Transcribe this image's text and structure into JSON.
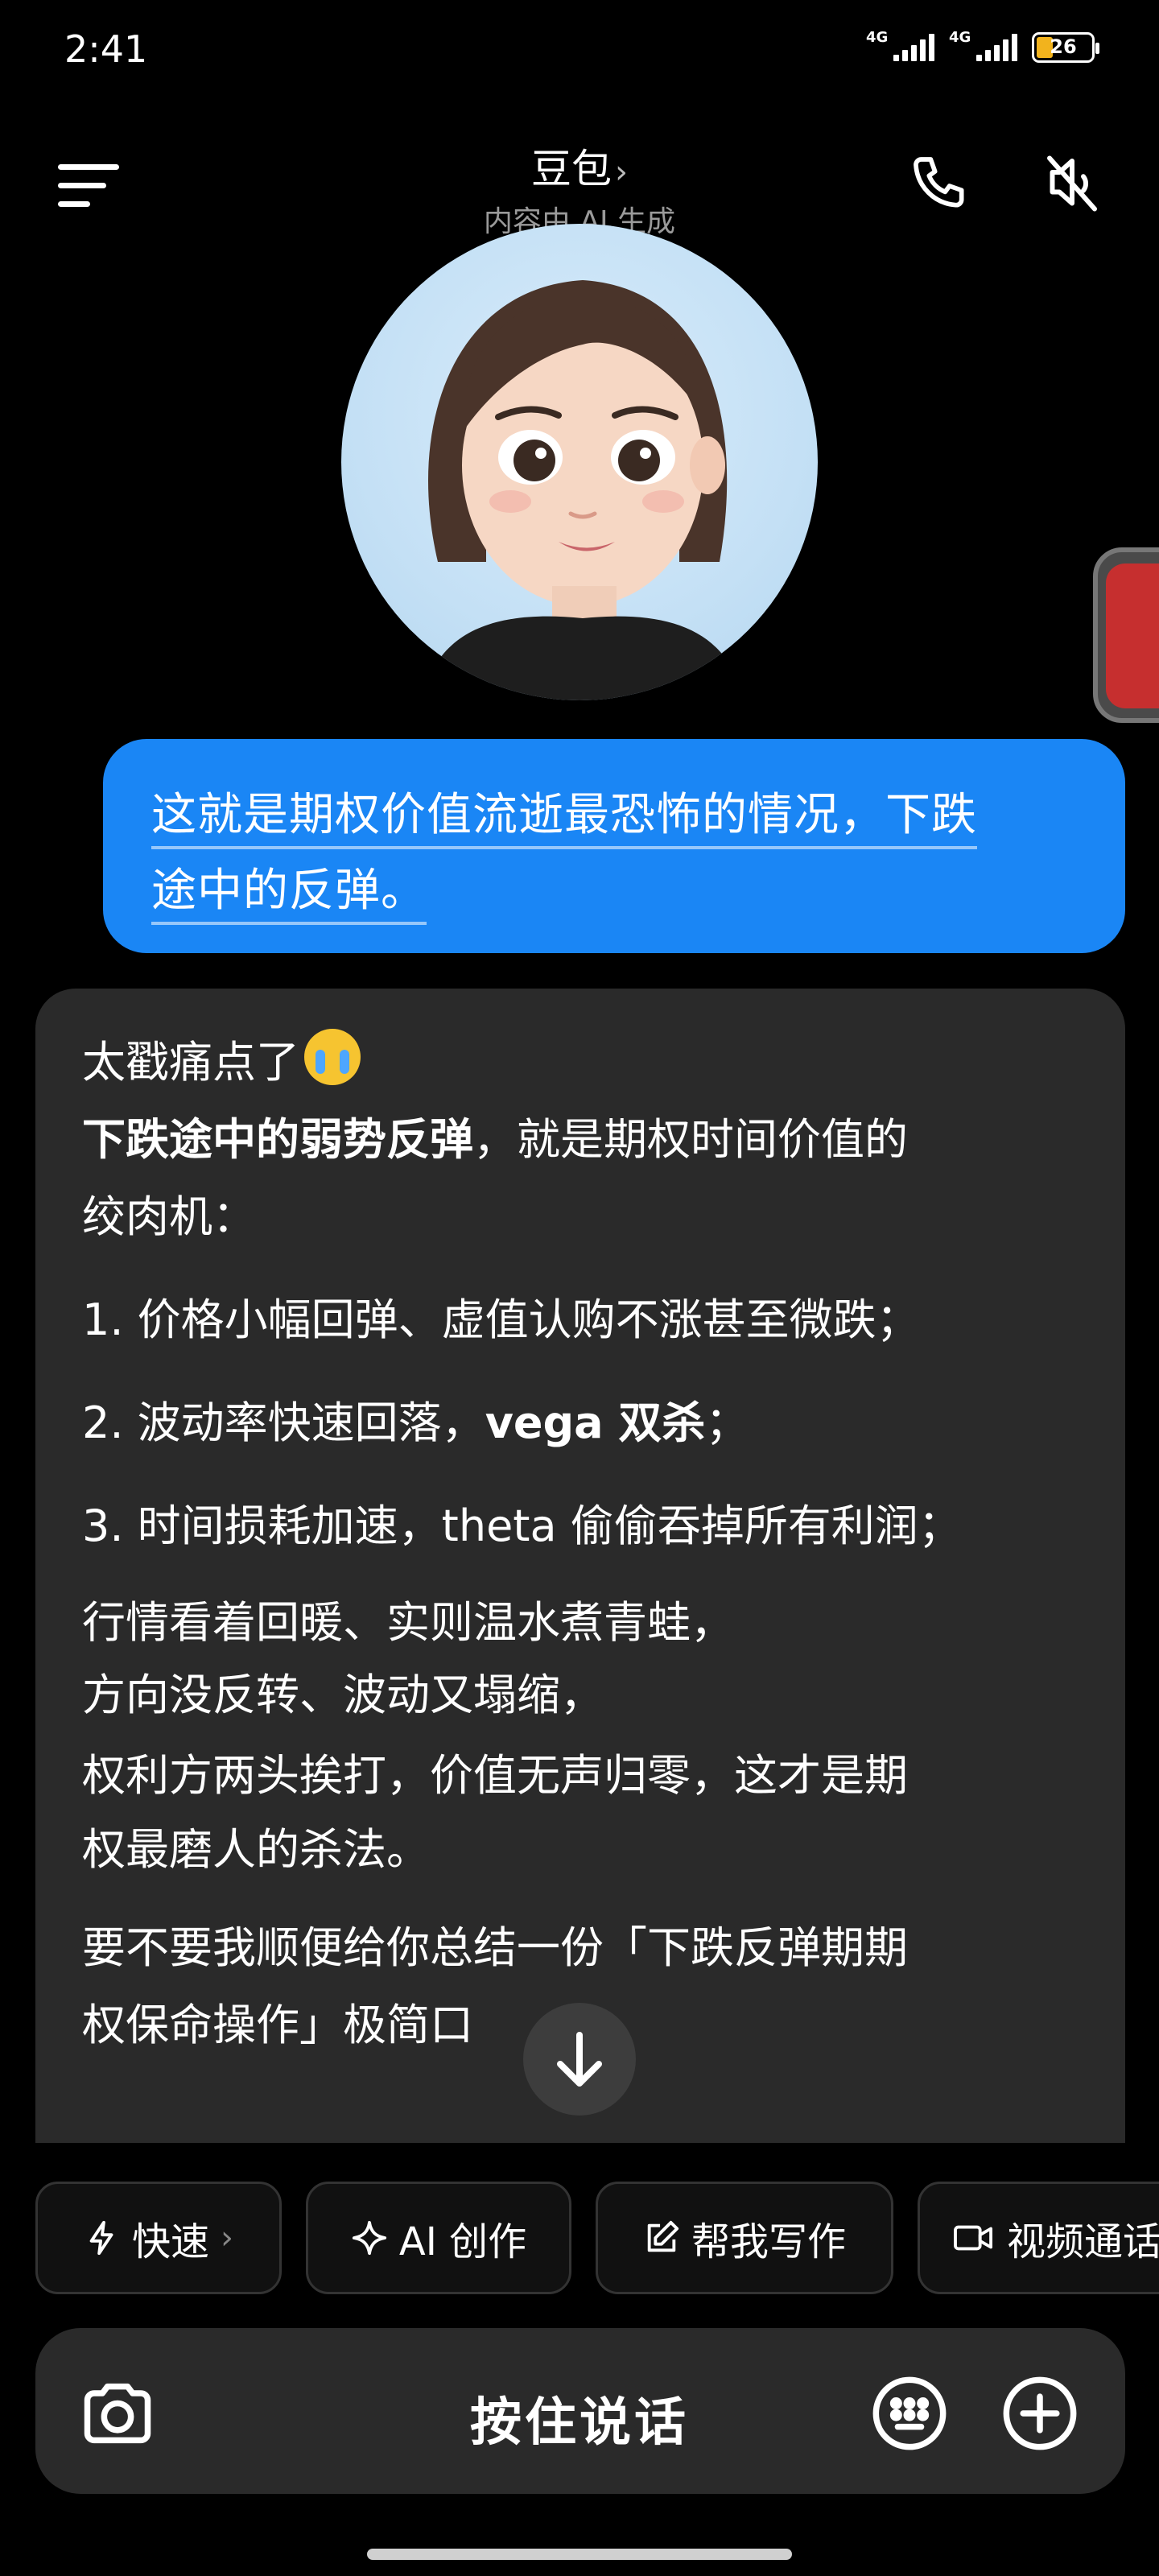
{
  "status_bar": {
    "time": "2:41",
    "network_1": "4G",
    "network_2": "4G",
    "battery": "26"
  },
  "header": {
    "title": "豆包",
    "title_chevron": "›",
    "subtitle": "内容由 AI 生成"
  },
  "user_message": {
    "line1": "这就是期权价值流逝最恐怖的情况，下跌",
    "line2": "途中的反弹。"
  },
  "bot_message": {
    "line1": "太戳痛点了",
    "line2_bold": "下跌途中的弱势反弹",
    "line2_rest": "，就是期权时间价值的",
    "line3": "绞肉机：",
    "item1": "1. 价格小幅回弹、虚值认购不涨甚至微跌；",
    "item2_pre": "2. 波动率快速回落，",
    "item2_bold": "vega 双杀",
    "item2_post": "；",
    "item3": "3. 时间损耗加速，theta 偷偷吞掉所有利润；",
    "para1": "行情看着回暖、实则温水煮青蛙，",
    "para2": "方向没反转、波动又塌缩，",
    "para3": "权利方两头挨打，价值无声归零，这才是期",
    "para4": "权最磨人的杀法。",
    "ask1": "要不要我顺便给你总结一份「下跌反弹期期",
    "ask2": "权保命操作」极简口"
  },
  "chips": [
    {
      "label": "快速",
      "chevron": "›"
    },
    {
      "label": "AI 创作"
    },
    {
      "label": "帮我写作"
    },
    {
      "label": "视频通话"
    }
  ],
  "input": {
    "hold_to_talk": "按住说话"
  },
  "colors": {
    "accent": "#1a86f5",
    "card": "#2a2a2a",
    "background": "#000000"
  }
}
